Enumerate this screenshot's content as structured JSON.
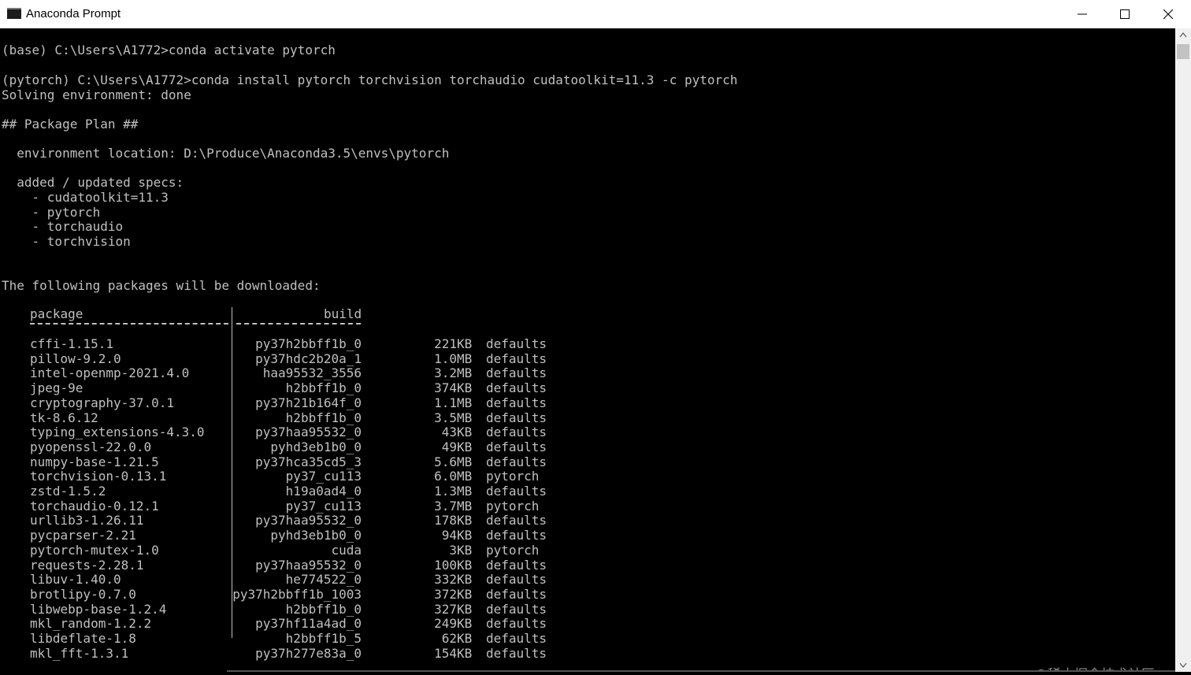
{
  "window": {
    "title": "Anaconda Prompt",
    "icons": {
      "app": "console-icon",
      "minimize": "minimize-icon",
      "maximize": "maximize-icon",
      "close": "close-icon"
    }
  },
  "console": {
    "lines": [
      "(base) C:\\Users\\A1772>conda activate pytorch",
      "(pytorch) C:\\Users\\A1772>conda install pytorch torchvision torchaudio cudatoolkit=11.3 -c pytorch",
      "Solving environment: done",
      "## Package Plan ##",
      "  environment location: D:\\Produce\\Anaconda3.5\\envs\\pytorch",
      "  added / updated specs:",
      "    - cudatoolkit=11.3",
      "    - pytorch",
      "    - torchaudio",
      "    - torchvision",
      "The following packages will be downloaded:"
    ],
    "table": {
      "header_package": "package",
      "header_build": "build",
      "rows": [
        {
          "name": "cffi-1.15.1",
          "build": "py37h2bbff1b_0",
          "size": "221",
          "unit": "KB",
          "channel": "defaults"
        },
        {
          "name": "pillow-9.2.0",
          "build": "py37hdc2b20a_1",
          "size": "1.0",
          "unit": "MB",
          "channel": "defaults"
        },
        {
          "name": "intel-openmp-2021.4.0",
          "build": "haa95532_3556",
          "size": "3.2",
          "unit": "MB",
          "channel": "defaults"
        },
        {
          "name": "jpeg-9e",
          "build": "h2bbff1b_0",
          "size": "374",
          "unit": "KB",
          "channel": "defaults"
        },
        {
          "name": "cryptography-37.0.1",
          "build": "py37h21b164f_0",
          "size": "1.1",
          "unit": "MB",
          "channel": "defaults"
        },
        {
          "name": "tk-8.6.12",
          "build": "h2bbff1b_0",
          "size": "3.5",
          "unit": "MB",
          "channel": "defaults"
        },
        {
          "name": "typing_extensions-4.3.0",
          "build": "py37haa95532_0",
          "size": "43",
          "unit": "KB",
          "channel": "defaults"
        },
        {
          "name": "pyopenssl-22.0.0",
          "build": "pyhd3eb1b0_0",
          "size": "49",
          "unit": "KB",
          "channel": "defaults"
        },
        {
          "name": "numpy-base-1.21.5",
          "build": "py37hca35cd5_3",
          "size": "5.6",
          "unit": "MB",
          "channel": "defaults"
        },
        {
          "name": "torchvision-0.13.1",
          "build": "py37_cu113",
          "size": "6.0",
          "unit": "MB",
          "channel": "pytorch"
        },
        {
          "name": "zstd-1.5.2",
          "build": "h19a0ad4_0",
          "size": "1.3",
          "unit": "MB",
          "channel": "defaults"
        },
        {
          "name": "torchaudio-0.12.1",
          "build": "py37_cu113",
          "size": "3.7",
          "unit": "MB",
          "channel": "pytorch"
        },
        {
          "name": "urllib3-1.26.11",
          "build": "py37haa95532_0",
          "size": "178",
          "unit": "KB",
          "channel": "defaults"
        },
        {
          "name": "pycparser-2.21",
          "build": "pyhd3eb1b0_0",
          "size": "94",
          "unit": "KB",
          "channel": "defaults"
        },
        {
          "name": "pytorch-mutex-1.0",
          "build": "cuda",
          "size": "3",
          "unit": "KB",
          "channel": "pytorch"
        },
        {
          "name": "requests-2.28.1",
          "build": "py37haa95532_0",
          "size": "100",
          "unit": "KB",
          "channel": "defaults"
        },
        {
          "name": "libuv-1.40.0",
          "build": "he774522_0",
          "size": "332",
          "unit": "KB",
          "channel": "defaults"
        },
        {
          "name": "brotlipy-0.7.0",
          "build": "py37h2bbff1b_1003",
          "size": "372",
          "unit": "KB",
          "channel": "defaults"
        },
        {
          "name": "libwebp-base-1.2.4",
          "build": "h2bbff1b_0",
          "size": "327",
          "unit": "KB",
          "channel": "defaults"
        },
        {
          "name": "mkl_random-1.2.2",
          "build": "py37hf11a4ad_0",
          "size": "249",
          "unit": "KB",
          "channel": "defaults"
        },
        {
          "name": "libdeflate-1.8",
          "build": "h2bbff1b_5",
          "size": "62",
          "unit": "KB",
          "channel": "defaults"
        },
        {
          "name": "mkl_fft-1.3.1",
          "build": "py37h277e83a_0",
          "size": "154",
          "unit": "KB",
          "channel": "defaults"
        }
      ]
    }
  },
  "watermark": "@稀土掘金技术社区",
  "colors": {
    "background": "#000000",
    "text": "#c0c0c0",
    "titlebar": "#ffffff"
  }
}
